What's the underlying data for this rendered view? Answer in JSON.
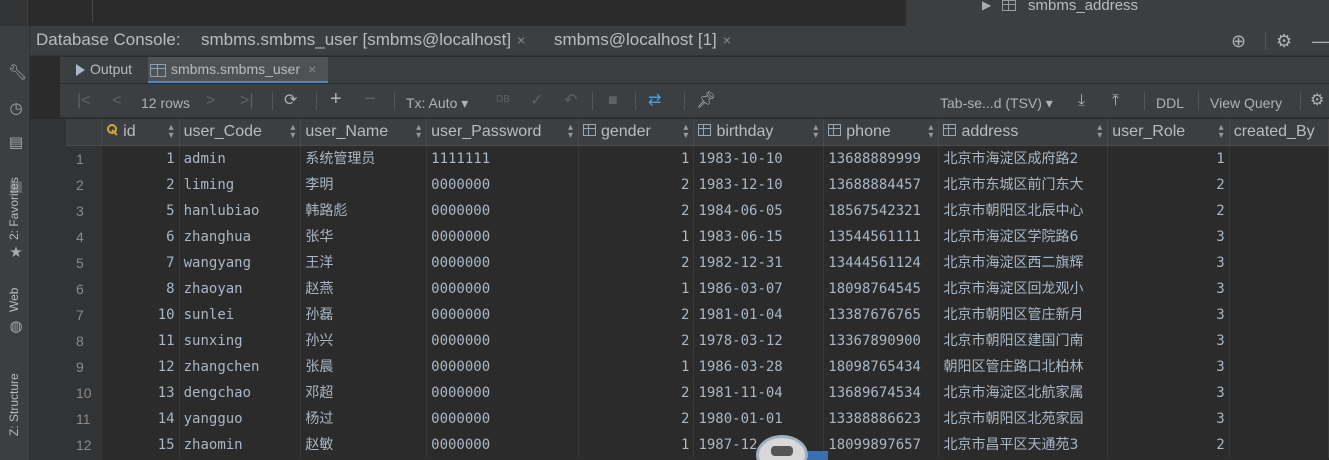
{
  "project_tree": {
    "item_label": "smbms_address"
  },
  "left_strip": {
    "favorites_label": "2: Favorites",
    "web_label": "Web",
    "structure_label": "Z: Structure"
  },
  "console": {
    "title": "Database Console:",
    "tabs": [
      {
        "label": "smbms.smbms_user [smbms@localhost]"
      },
      {
        "label": "smbms@localhost [1]"
      }
    ],
    "close_glyph": "×"
  },
  "results_tabs": [
    {
      "label": "Output"
    },
    {
      "label": "smbms.smbms_user"
    }
  ],
  "toolbar": {
    "rows_label": "12 rows",
    "tx_label": "Tx: Auto",
    "export_format": "Tab-se...d (TSV)",
    "ddl_label": "DDL",
    "view_query_label": "View Query"
  },
  "table": {
    "columns": [
      "id",
      "user_Code",
      "user_Name",
      "user_Password",
      "gender",
      "birthday",
      "phone",
      "address",
      "user_Role",
      "created_By"
    ],
    "rows": [
      [
        "1",
        "1",
        "admin",
        "系统管理员",
        "1111111",
        "1",
        "1983-10-10",
        "13688889999",
        "北京市海淀区成府路2",
        "1"
      ],
      [
        "2",
        "2",
        "liming",
        "李明",
        "0000000",
        "2",
        "1983-12-10",
        "13688884457",
        "北京市东城区前门东大",
        "2"
      ],
      [
        "3",
        "5",
        "hanlubiao",
        "韩路彪",
        "0000000",
        "2",
        "1984-06-05",
        "18567542321",
        "北京市朝阳区北辰中心",
        "2"
      ],
      [
        "4",
        "6",
        "zhanghua",
        "张华",
        "0000000",
        "1",
        "1983-06-15",
        "13544561111",
        "北京市海淀区学院路6",
        "3"
      ],
      [
        "5",
        "7",
        "wangyang",
        "王洋",
        "0000000",
        "2",
        "1982-12-31",
        "13444561124",
        "北京市海淀区西二旗辉",
        "3"
      ],
      [
        "6",
        "8",
        "zhaoyan",
        "赵燕",
        "0000000",
        "1",
        "1986-03-07",
        "18098764545",
        "北京市海淀区回龙观小",
        "3"
      ],
      [
        "7",
        "10",
        "sunlei",
        "孙磊",
        "0000000",
        "2",
        "1981-01-04",
        "13387676765",
        "北京市朝阳区管庄新月",
        "3"
      ],
      [
        "8",
        "11",
        "sunxing",
        "孙兴",
        "0000000",
        "2",
        "1978-03-12",
        "13367890900",
        "北京市朝阳区建国门南",
        "3"
      ],
      [
        "9",
        "12",
        "zhangchen",
        "张晨",
        "0000000",
        "1",
        "1986-03-28",
        "18098765434",
        "朝阳区管庄路口北柏林",
        "3"
      ],
      [
        "10",
        "13",
        "dengchao",
        "邓超",
        "0000000",
        "2",
        "1981-11-04",
        "13689674534",
        "北京市海淀区北航家属",
        "3"
      ],
      [
        "11",
        "14",
        "yangguo",
        "杨过",
        "0000000",
        "2",
        "1980-01-01",
        "13388886623",
        "北京市朝阳区北苑家园",
        "3"
      ],
      [
        "12",
        "15",
        "zhaomin",
        "赵敏",
        "0000000",
        "1",
        "1987-12",
        "18099897657",
        "北京市昌平区天通苑3",
        "2"
      ]
    ]
  }
}
